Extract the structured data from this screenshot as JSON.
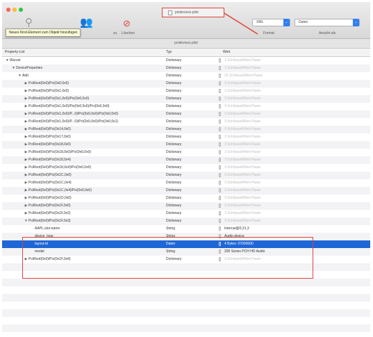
{
  "window": {
    "title": "pcidevices.plist",
    "tab_title": "pcidevices.plist"
  },
  "toolbar": {
    "tooltip": "Neues Kind-Element zum Objekt hinzufügen",
    "delete_label": "Löschen",
    "delete_prefix": "zu",
    "format_select": "XML",
    "format_label": "Format",
    "view_select": "Daten",
    "view_label": "Ansicht als"
  },
  "columns": {
    "property": "Property-List",
    "type": "Typ",
    "value": "Wert"
  },
  "rows": [
    {
      "key": "Wurzel",
      "indent": 0,
      "disc": "▼",
      "type": "Dictionary",
      "value": "1 Schlüssel/Wert-Paare",
      "muted": true
    },
    {
      "key": "DeviceProperties",
      "indent": 1,
      "disc": "▼",
      "type": "Dictionary",
      "value": "1 Schlüssel/Wert-Paare",
      "muted": true
    },
    {
      "key": "Add",
      "indent": 2,
      "disc": "▼",
      "type": "Dictionary",
      "value": "22 Schlüssel/Wert-Paare",
      "muted": true
    },
    {
      "key": "PciRoot(0x0)/Pci(0x0,0x0)",
      "indent": 3,
      "disc": "▶",
      "type": "Dictionary",
      "value": "3 Schlüssel/Wert-Paare",
      "muted": true
    },
    {
      "key": "PciRoot(0x0)/Pci(0x1,0x0)",
      "indent": 3,
      "disc": "▶",
      "type": "Dictionary",
      "value": "3 Schlüssel/Wert-Paare",
      "muted": true
    },
    {
      "key": "PciRoot(0x0)/Pci(0x1,0x0)/Pci(0x0,0x0)",
      "indent": 3,
      "disc": "▶",
      "type": "Dictionary",
      "value": "3 Schlüssel/Wert-Paare",
      "muted": true
    },
    {
      "key": "PciRoot(0x0)/Pci(0x1,0x0)/Pci(0x0,0x0)/Pci(0x0,0x0)",
      "indent": 3,
      "disc": "▶",
      "type": "Dictionary",
      "value": "3 Schlüssel/Wert-Paare",
      "muted": true
    },
    {
      "key": "PciRoot(0x0)/Pci(0x1,0x0)/P...0)/Pci(0x0,0x0)/Pci(0x0,0x0)",
      "indent": 3,
      "disc": "▶",
      "type": "Dictionary",
      "value": "3 Schlüssel/Wert-Paare",
      "muted": true
    },
    {
      "key": "PciRoot(0x0)/Pci(0x1,0x0)/P...0)/Pci(0x0,0x0)/Pci(0x0,0x1)",
      "indent": 3,
      "disc": "▶",
      "type": "Dictionary",
      "value": "3 Schlüssel/Wert-Paare",
      "muted": true
    },
    {
      "key": "PciRoot(0x0)/Pci(0x14,0x0)",
      "indent": 3,
      "disc": "▶",
      "type": "Dictionary",
      "value": "3 Schlüssel/Wert-Paare",
      "muted": true
    },
    {
      "key": "PciRoot(0x0)/Pci(0x17,0x0)",
      "indent": 3,
      "disc": "▶",
      "type": "Dictionary",
      "value": "3 Schlüssel/Wert-Paare",
      "muted": true
    },
    {
      "key": "PciRoot(0x0)/Pci(0x18,0x0)",
      "indent": 3,
      "disc": "▶",
      "type": "Dictionary",
      "value": "3 Schlüssel/Wert-Paare",
      "muted": true
    },
    {
      "key": "PciRoot(0x0)/Pci(0x18,0x0)/Pci(0x0,0x0)",
      "indent": 3,
      "disc": "▶",
      "type": "Dictionary",
      "value": "3 Schlüssel/Wert-Paare",
      "muted": true
    },
    {
      "key": "PciRoot(0x0)/Pci(0x18,0x4)",
      "indent": 3,
      "disc": "▶",
      "type": "Dictionary",
      "value": "3 Schlüssel/Wert-Paare",
      "muted": true
    },
    {
      "key": "PciRoot(0x0)/Pci(0x18,0x4)/Pci(0x0,0x0)",
      "indent": 3,
      "disc": "▶",
      "type": "Dictionary",
      "value": "3 Schlüssel/Wert-Paare",
      "muted": true
    },
    {
      "key": "PciRoot(0x0)/Pci(0x1C,0x0)",
      "indent": 3,
      "disc": "▶",
      "type": "Dictionary",
      "value": "3 Schlüssel/Wert-Paare",
      "muted": true
    },
    {
      "key": "PciRoot(0x0)/Pci(0x1C,0x4)",
      "indent": 3,
      "disc": "▶",
      "type": "Dictionary",
      "value": "3 Schlüssel/Wert-Paare",
      "muted": true
    },
    {
      "key": "PciRoot(0x0)/Pci(0x1C,0x4)/Pci(0x0,0x0)",
      "indent": 3,
      "disc": "▶",
      "type": "Dictionary",
      "value": "3 Schlüssel/Wert-Paare",
      "muted": true
    },
    {
      "key": "PciRoot(0x0)/Pci(0x1D,0x0)",
      "indent": 3,
      "disc": "▶",
      "type": "Dictionary",
      "value": "3 Schlüssel/Wert-Paare",
      "muted": true
    },
    {
      "key": "PciRoot(0x0)/Pci(0x1F,0x0)",
      "indent": 3,
      "disc": "▶",
      "type": "Dictionary",
      "value": "3 Schlüssel/Wert-Paare",
      "muted": true
    },
    {
      "key": "PciRoot(0x0)/Pci(0x1F,0x2)",
      "indent": 3,
      "disc": "▶",
      "type": "Dictionary",
      "value": "3 Schlüssel/Wert-Paare",
      "muted": true
    },
    {
      "key": "PciRoot(0x0)/Pci(0x1F,0x3)",
      "indent": 3,
      "disc": "▼",
      "type": "Dictionary",
      "value": "3 Schlüssel/Wert-Paare",
      "muted": true
    },
    {
      "key": "AAPL,slot-name",
      "indent": 4,
      "disc": "",
      "type": "String",
      "value": "Internal@0,31,3",
      "muted": false
    },
    {
      "key": "device_type",
      "indent": 4,
      "disc": "",
      "type": "String",
      "value": "Audio device",
      "muted": false
    },
    {
      "key": "layout-id",
      "indent": 4,
      "disc": "",
      "type": "Daten",
      "value": "4 Bytes: 07000000",
      "muted": false,
      "selected": true
    },
    {
      "key": "model",
      "indent": 4,
      "disc": "",
      "type": "String",
      "value": "200 Series PCH HD Audio",
      "muted": false
    },
    {
      "key": "PciRoot(0x0)/Pci(0x1F,0x4)",
      "indent": 3,
      "disc": "▶",
      "type": "Dictionary",
      "value": "3 Schlüssel/Wert-Paare",
      "muted": true
    }
  ],
  "colors": {
    "annotation": "#e0413a",
    "selection": "#1f67d6",
    "accent": "#2f7ff3"
  }
}
